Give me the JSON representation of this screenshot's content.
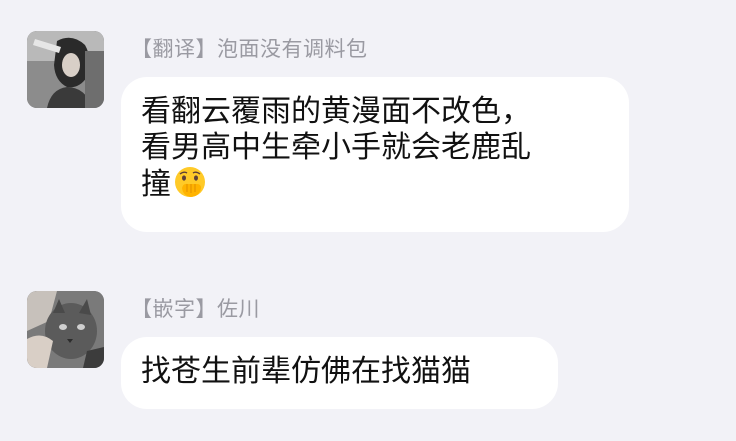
{
  "messages": [
    {
      "tag": "【翻译】",
      "name": "泡面没有调料包",
      "lines": [
        "看翻云覆雨的黄漫面不改色，",
        "看男高中生牵小手就会老鹿乱",
        "撞"
      ],
      "emoji": "hand-over-mouth-emoji"
    },
    {
      "tag": "【嵌字】",
      "name": "佐川",
      "lines": [
        "找苍生前辈仿佛在找猫猫"
      ]
    }
  ],
  "colors": {
    "background": "#f2f2f7",
    "bubble": "#ffffff",
    "sender_text": "#9a9aa2",
    "message_text": "#111111"
  }
}
